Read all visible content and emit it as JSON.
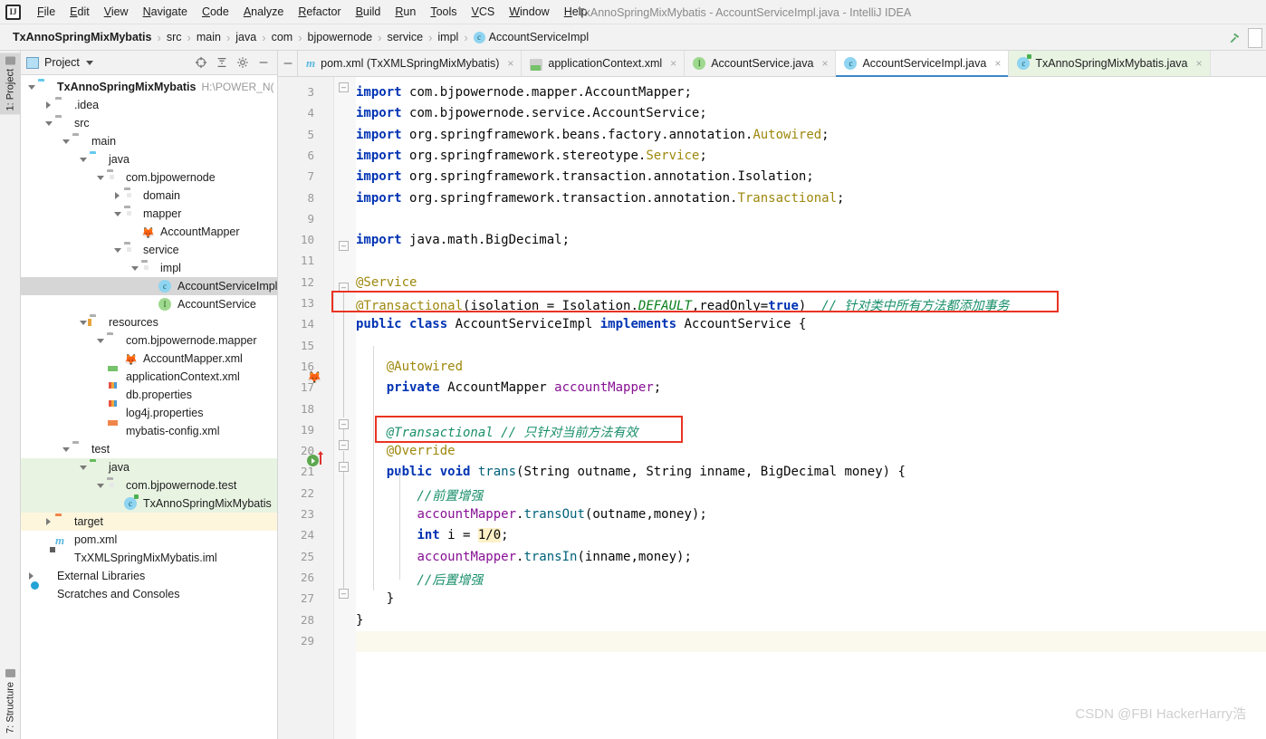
{
  "window": {
    "title": "TxAnnoSpringMixMybatis - AccountServiceImpl.java - IntelliJ IDEA",
    "logo": "IJ"
  },
  "menu": {
    "items": [
      {
        "label": "File",
        "icon": "menu-file"
      },
      {
        "label": "Edit",
        "icon": "menu-edit"
      },
      {
        "label": "View",
        "icon": "menu-view"
      },
      {
        "label": "Navigate",
        "icon": "menu-navigate"
      },
      {
        "label": "Code",
        "icon": "menu-code"
      },
      {
        "label": "Analyze",
        "icon": "menu-analyze"
      },
      {
        "label": "Refactor",
        "icon": "menu-refactor"
      },
      {
        "label": "Build",
        "icon": "menu-build"
      },
      {
        "label": "Run",
        "icon": "menu-run"
      },
      {
        "label": "Tools",
        "icon": "menu-tools"
      },
      {
        "label": "VCS",
        "icon": "menu-vcs"
      },
      {
        "label": "Window",
        "icon": "menu-window"
      },
      {
        "label": "Help",
        "icon": "menu-help"
      }
    ]
  },
  "breadcrumb": {
    "items": [
      {
        "label": "TxAnnoSpringMixMybatis",
        "bold": true,
        "icon": ""
      },
      {
        "label": "src",
        "bold": false,
        "icon": ""
      },
      {
        "label": "main",
        "bold": false,
        "icon": ""
      },
      {
        "label": "java",
        "bold": false,
        "icon": ""
      },
      {
        "label": "com",
        "bold": false,
        "icon": ""
      },
      {
        "label": "bjpowernode",
        "bold": false,
        "icon": ""
      },
      {
        "label": "service",
        "bold": false,
        "icon": ""
      },
      {
        "label": "impl",
        "bold": false,
        "icon": ""
      },
      {
        "label": "AccountServiceImpl",
        "bold": false,
        "icon": "class-badge"
      }
    ],
    "separator": "›",
    "class_badge_letter": "c"
  },
  "toolstrip": {
    "top_tab": "1: Project",
    "bottom_tab": "7: Structure"
  },
  "project_panel": {
    "header_label": "Project",
    "tools": [
      "target-icon",
      "collapse-all-icon",
      "settings-gear-icon",
      "hide-icon"
    ],
    "tree": [
      {
        "label": "TxAnnoSpringMixMybatis",
        "sub": "H:\\POWER_N(",
        "depth": 0,
        "arrow": "down",
        "icon": "module-icon",
        "bold": true,
        "state": "none"
      },
      {
        "label": ".idea",
        "sub": "",
        "depth": 1,
        "arrow": "right",
        "icon": "folder-icon",
        "bold": false,
        "state": "none"
      },
      {
        "label": "src",
        "sub": "",
        "depth": 1,
        "arrow": "down",
        "icon": "folder-icon",
        "bold": false,
        "state": "none"
      },
      {
        "label": "main",
        "sub": "",
        "depth": 2,
        "arrow": "down",
        "icon": "folder-icon",
        "bold": false,
        "state": "none"
      },
      {
        "label": "java",
        "sub": "",
        "depth": 3,
        "arrow": "down",
        "icon": "source-folder-icon",
        "bold": false,
        "state": "none"
      },
      {
        "label": "com.bjpowernode",
        "sub": "",
        "depth": 4,
        "arrow": "down",
        "icon": "package-icon",
        "bold": false,
        "state": "none"
      },
      {
        "label": "domain",
        "sub": "",
        "depth": 5,
        "arrow": "right",
        "icon": "package-icon",
        "bold": false,
        "state": "none"
      },
      {
        "label": "mapper",
        "sub": "",
        "depth": 5,
        "arrow": "down",
        "icon": "package-icon",
        "bold": false,
        "state": "none"
      },
      {
        "label": "AccountMapper",
        "sub": "",
        "depth": 6,
        "arrow": "none",
        "icon": "mybatis-mapper-icon",
        "bold": false,
        "state": "none"
      },
      {
        "label": "service",
        "sub": "",
        "depth": 5,
        "arrow": "down",
        "icon": "package-icon",
        "bold": false,
        "state": "none"
      },
      {
        "label": "impl",
        "sub": "",
        "depth": 6,
        "arrow": "down",
        "icon": "package-icon",
        "bold": false,
        "state": "none"
      },
      {
        "label": "AccountServiceImpl",
        "sub": "",
        "depth": 7,
        "arrow": "none",
        "icon": "java-class-icon",
        "bold": false,
        "state": "selected"
      },
      {
        "label": "AccountService",
        "sub": "",
        "depth": 7,
        "arrow": "none",
        "icon": "java-interface-icon",
        "bold": false,
        "state": "none"
      },
      {
        "label": "resources",
        "sub": "",
        "depth": 3,
        "arrow": "down",
        "icon": "resources-folder-icon",
        "bold": false,
        "state": "none"
      },
      {
        "label": "com.bjpowernode.mapper",
        "sub": "",
        "depth": 4,
        "arrow": "down",
        "icon": "folder-icon",
        "bold": false,
        "state": "none"
      },
      {
        "label": "AccountMapper.xml",
        "sub": "",
        "depth": 5,
        "arrow": "none",
        "icon": "mybatis-mapper-icon",
        "bold": false,
        "state": "none"
      },
      {
        "label": "applicationContext.xml",
        "sub": "",
        "depth": 4,
        "arrow": "none",
        "icon": "spring-xml-icon",
        "bold": false,
        "state": "none"
      },
      {
        "label": "db.properties",
        "sub": "",
        "depth": 4,
        "arrow": "none",
        "icon": "properties-icon",
        "bold": false,
        "state": "none"
      },
      {
        "label": "log4j.properties",
        "sub": "",
        "depth": 4,
        "arrow": "none",
        "icon": "properties-icon",
        "bold": false,
        "state": "none"
      },
      {
        "label": "mybatis-config.xml",
        "sub": "",
        "depth": 4,
        "arrow": "none",
        "icon": "xml-icon",
        "bold": false,
        "state": "none"
      },
      {
        "label": "test",
        "sub": "",
        "depth": 2,
        "arrow": "down",
        "icon": "folder-icon",
        "bold": false,
        "state": "none"
      },
      {
        "label": "java",
        "sub": "",
        "depth": 3,
        "arrow": "down",
        "icon": "test-source-folder-icon",
        "bold": false,
        "state": "green"
      },
      {
        "label": "com.bjpowernode.test",
        "sub": "",
        "depth": 4,
        "arrow": "down",
        "icon": "package-icon",
        "bold": false,
        "state": "green"
      },
      {
        "label": "TxAnnoSpringMixMybatis",
        "sub": "",
        "depth": 5,
        "arrow": "none",
        "icon": "java-test-class-icon",
        "bold": false,
        "state": "green"
      },
      {
        "label": "target",
        "sub": "",
        "depth": 1,
        "arrow": "right",
        "icon": "excluded-folder-icon",
        "bold": false,
        "state": "yellow"
      },
      {
        "label": "pom.xml",
        "sub": "",
        "depth": 1,
        "arrow": "none",
        "icon": "maven-icon",
        "bold": false,
        "state": "none"
      },
      {
        "label": "TxXMLSpringMixMybatis.iml",
        "sub": "",
        "depth": 1,
        "arrow": "none",
        "icon": "iml-icon",
        "bold": false,
        "state": "none"
      },
      {
        "label": "External Libraries",
        "sub": "",
        "depth": 0,
        "arrow": "right",
        "icon": "libraries-icon",
        "bold": false,
        "state": "none"
      },
      {
        "label": "Scratches and Consoles",
        "sub": "",
        "depth": 0,
        "arrow": "none",
        "icon": "scratches-icon",
        "bold": false,
        "state": "none"
      }
    ]
  },
  "editor_tabs": [
    {
      "label": "pom.xml (TxXMLSpringMixMybatis)",
      "icon": "maven-icon",
      "active": false,
      "bg": "plain",
      "close": "×"
    },
    {
      "label": "applicationContext.xml",
      "icon": "spring-xml-icon",
      "active": false,
      "bg": "plain",
      "close": "×"
    },
    {
      "label": "AccountService.java",
      "icon": "java-interface-icon",
      "active": false,
      "bg": "plain",
      "close": "×"
    },
    {
      "label": "AccountServiceImpl.java",
      "icon": "java-class-icon",
      "active": true,
      "bg": "plain",
      "close": "×"
    },
    {
      "label": "TxAnnoSpringMixMybatis.java",
      "icon": "java-test-class-icon",
      "active": false,
      "bg": "green",
      "close": "×"
    }
  ],
  "editor": {
    "first_line": 3,
    "lines": [
      {
        "n": 3,
        "tokens": [
          {
            "t": "import ",
            "c": "k"
          },
          {
            "t": "com.bjpowernode.mapper.AccountMapper;",
            "c": "plain"
          }
        ]
      },
      {
        "n": 4,
        "tokens": [
          {
            "t": "import ",
            "c": "k"
          },
          {
            "t": "com.bjpowernode.service.AccountService;",
            "c": "plain"
          }
        ]
      },
      {
        "n": 5,
        "tokens": [
          {
            "t": "import ",
            "c": "k"
          },
          {
            "t": "org.springframework.beans.factory.annotation.",
            "c": "plain"
          },
          {
            "t": "Autowired",
            "c": "an"
          },
          {
            "t": ";",
            "c": "plain"
          }
        ]
      },
      {
        "n": 6,
        "tokens": [
          {
            "t": "import ",
            "c": "k"
          },
          {
            "t": "org.springframework.stereotype.",
            "c": "plain"
          },
          {
            "t": "Service",
            "c": "an"
          },
          {
            "t": ";",
            "c": "plain"
          }
        ]
      },
      {
        "n": 7,
        "tokens": [
          {
            "t": "import ",
            "c": "k"
          },
          {
            "t": "org.springframework.transaction.annotation.Isolation;",
            "c": "plain"
          }
        ]
      },
      {
        "n": 8,
        "tokens": [
          {
            "t": "import ",
            "c": "k"
          },
          {
            "t": "org.springframework.transaction.annotation.",
            "c": "plain"
          },
          {
            "t": "Transactional",
            "c": "an"
          },
          {
            "t": ";",
            "c": "plain"
          }
        ]
      },
      {
        "n": 9,
        "tokens": []
      },
      {
        "n": 10,
        "tokens": [
          {
            "t": "import ",
            "c": "k"
          },
          {
            "t": "java.math.BigDecimal;",
            "c": "plain"
          }
        ]
      },
      {
        "n": 11,
        "tokens": []
      },
      {
        "n": 12,
        "tokens": [
          {
            "t": "@Service",
            "c": "an"
          }
        ]
      },
      {
        "n": 13,
        "tokens": [
          {
            "t": "@Transactional",
            "c": "an"
          },
          {
            "t": "(isolation = Isolation.",
            "c": "plain"
          },
          {
            "t": "DEFAULT",
            "c": "st-italic"
          },
          {
            "t": ",readOnly=",
            "c": "plain"
          },
          {
            "t": "true",
            "c": "k"
          },
          {
            "t": ")",
            "c": "plain"
          },
          {
            "t": "  // 针对类中所有方法都添加事务",
            "c": "cm"
          }
        ]
      },
      {
        "n": 14,
        "tokens": [
          {
            "t": "public ",
            "c": "k"
          },
          {
            "t": "class ",
            "c": "k"
          },
          {
            "t": "AccountServiceImpl ",
            "c": "plain"
          },
          {
            "t": "implements ",
            "c": "k"
          },
          {
            "t": "AccountService {",
            "c": "plain"
          }
        ]
      },
      {
        "n": 15,
        "tokens": []
      },
      {
        "n": 16,
        "tokens": [
          {
            "t": "    @Autowired",
            "c": "an"
          }
        ]
      },
      {
        "n": 17,
        "tokens": [
          {
            "t": "    private ",
            "c": "k"
          },
          {
            "t": "AccountMapper ",
            "c": "plain"
          },
          {
            "t": "accountMapper",
            "c": "fld"
          },
          {
            "t": ";",
            "c": "plain"
          }
        ]
      },
      {
        "n": 18,
        "tokens": []
      },
      {
        "n": 19,
        "tokens": [
          {
            "t": "    @Transactional",
            "c": "cm"
          },
          {
            "t": " // 只针对当前方法有效",
            "c": "cm"
          }
        ]
      },
      {
        "n": 20,
        "tokens": [
          {
            "t": "    @Override",
            "c": "an"
          }
        ]
      },
      {
        "n": 21,
        "tokens": [
          {
            "t": "    public ",
            "c": "k"
          },
          {
            "t": "void ",
            "c": "k"
          },
          {
            "t": "trans",
            "c": "mth"
          },
          {
            "t": "(String ",
            "c": "plain"
          },
          {
            "t": "outname",
            "c": "plain"
          },
          {
            "t": ", String ",
            "c": "plain"
          },
          {
            "t": "inname",
            "c": "plain"
          },
          {
            "t": ", BigDecimal ",
            "c": "plain"
          },
          {
            "t": "money",
            "c": "plain"
          },
          {
            "t": ") {",
            "c": "plain"
          }
        ]
      },
      {
        "n": 22,
        "tokens": [
          {
            "t": "        //前置增强",
            "c": "cm"
          }
        ]
      },
      {
        "n": 23,
        "tokens": [
          {
            "t": "        ",
            "c": "plain"
          },
          {
            "t": "accountMapper",
            "c": "fld"
          },
          {
            "t": ".",
            "c": "plain"
          },
          {
            "t": "transOut",
            "c": "mth"
          },
          {
            "t": "(outname,money);",
            "c": "plain"
          }
        ]
      },
      {
        "n": 24,
        "tokens": [
          {
            "t": "        ",
            "c": "plain"
          },
          {
            "t": "int ",
            "c": "k"
          },
          {
            "t": "i = ",
            "c": "plain"
          },
          {
            "t": "1/0",
            "c": "num"
          },
          {
            "t": ";",
            "c": "plain"
          }
        ]
      },
      {
        "n": 25,
        "tokens": [
          {
            "t": "        ",
            "c": "plain"
          },
          {
            "t": "accountMapper",
            "c": "fld"
          },
          {
            "t": ".",
            "c": "plain"
          },
          {
            "t": "transIn",
            "c": "mth"
          },
          {
            "t": "(inname,money);",
            "c": "plain"
          }
        ]
      },
      {
        "n": 26,
        "tokens": [
          {
            "t": "        //后置增强",
            "c": "cm"
          }
        ]
      },
      {
        "n": 27,
        "tokens": [
          {
            "t": "    }",
            "c": "plain"
          }
        ]
      },
      {
        "n": 28,
        "tokens": [
          {
            "t": "}",
            "c": "plain"
          }
        ]
      },
      {
        "n": 29,
        "tokens": [],
        "highlight": true
      }
    ],
    "annotations": {
      "box1_line": 13,
      "box1_note": "针对类中所有方法都添加事务",
      "box2_line": 19,
      "box2_note": "只针对当前方法有效",
      "box_color": "#ea3323"
    }
  },
  "watermark": "CSDN @FBI HackerHarry浩",
  "colors": {
    "accent": "#3d87c9",
    "annotation": "#9e880d",
    "keyword": "#0033b3",
    "comment": "#1a8f6b",
    "field": "#871094",
    "method": "#00627a",
    "highlight_box": "#ea3323",
    "selected_row": "#d6d6d6",
    "test_green": "#e8f3e2",
    "excluded_yellow": "#fdf6dd"
  }
}
